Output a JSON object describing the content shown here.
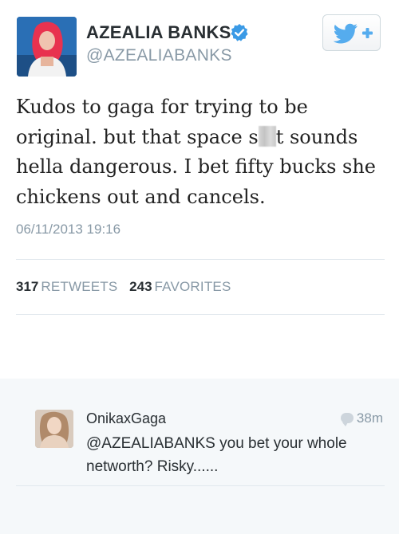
{
  "tweet": {
    "display_name": "AZEALIA BANKS",
    "handle": "@AZEALIABANKS",
    "text_before": "Kudos to gaga for trying to be original. but that space s",
    "text_after": "t sounds hella dangerous. I bet fifty bucks she chickens out and cancels.",
    "timestamp": "06/11/2013 19:16",
    "retweets_count": "317",
    "retweets_label": "RETWEETS",
    "favorites_count": "243",
    "favorites_label": "FAVORITES",
    "icons": {
      "verified": "verified-badge-icon",
      "follow": "twitter-bird-plus-icon"
    },
    "colors": {
      "brand_blue": "#55acee",
      "verified_blue": "#3a9ae6",
      "muted_gray": "#8899a6"
    }
  },
  "reply": {
    "display_name": "OnikaxGaga",
    "time": "38m",
    "text": "@AZEALIABANKS you bet your whole networth? Risky......",
    "icons": {
      "time": "speech-bubble-icon"
    }
  }
}
